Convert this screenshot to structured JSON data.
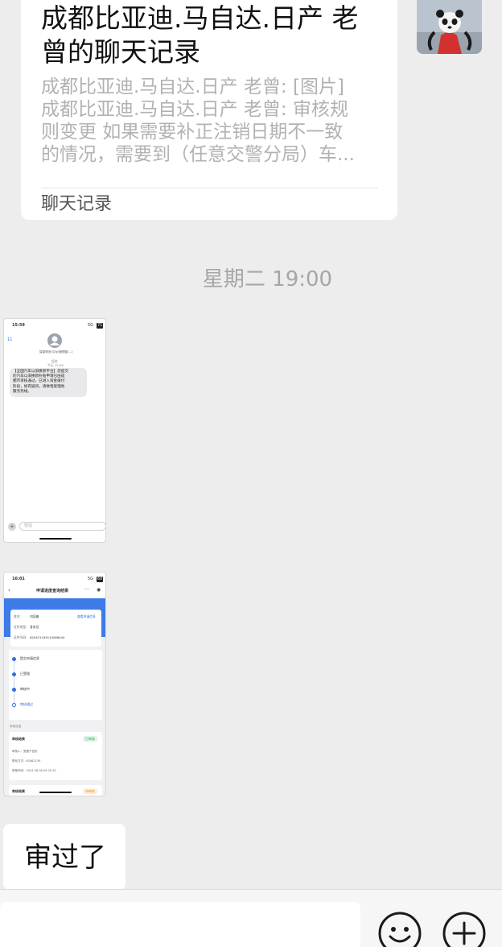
{
  "chat_card": {
    "title_line1": "成都比亚迪.马自达.日产  老",
    "title_line2": "曾的聊天记录",
    "preview_lines": [
      "成都比亚迪.马自达.日产  老曾: [图片]",
      "成都比亚迪.马自达.日产  老曾: 审核规",
      "则变更 如果需要补正注销日期不一致",
      "的情况，需要到（任意交警分局）车..."
    ],
    "footer": "聊天记录"
  },
  "avatar": {
    "icon": "panda-avatar-icon"
  },
  "timestamp": "星期二 19:00",
  "sms_screenshot": {
    "time": "15:59",
    "signal": "5G",
    "battery": "71",
    "back_count": "11",
    "contact": "智能物流(平台)管理部(…)",
    "date_label": "短信",
    "date_time": "今天 15:58",
    "message_lines": [
      "【全国汽车以旧换新平台】您提交",
      "的汽车以旧换新补贴申请已由成",
      "都市审核通过，已进入资金拨付",
      "阶段，如有疑问，请致电受理地",
      "服务热线。"
    ],
    "input_placeholder": "短信"
  },
  "query_screenshot": {
    "time": "16:01",
    "signal": "5G",
    "battery": "60",
    "header_title": "申请进度查询结果",
    "info_rows": [
      {
        "label": "姓名：",
        "value": "刘培敏"
      },
      {
        "label": "证件类型：",
        "value": "身份证"
      },
      {
        "label": "证件号码：",
        "value": "620421199110066444"
      }
    ],
    "info_link": "查看申请信息",
    "steps": [
      "提交申请信息",
      "已受理",
      "审核中",
      "审核通过"
    ],
    "section_label": "审核进度",
    "result_title": "审核结果",
    "result_badge": "已审核",
    "result_rows": [
      "审核人：受理产品份",
      "联系方式：81862159",
      "审核时间：2024-08-06 09:30:30"
    ],
    "second_title": "审核结果",
    "second_badge": "待审核"
  },
  "message": {
    "text": "审过了"
  },
  "input_bar": {
    "emoji_icon": "emoji-icon",
    "plus_icon": "plus-icon"
  }
}
